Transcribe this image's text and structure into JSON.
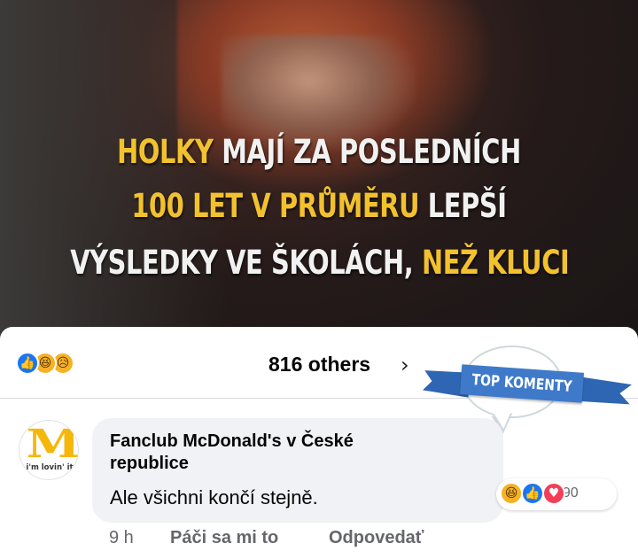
{
  "meme": {
    "line1_hl": "HOLKY",
    "line1_rest": " MAJÍ ZA POSLEDNÍCH",
    "line2_hl": "100 LET V PRŮMĚRU",
    "line2_rest": " LEPŠÍ",
    "line3_rest": "VÝSLEDKY VE ŠKOLÁCH, ",
    "line3_hl": "NEŽ KLUCI",
    "highlight_color": "#f2c12e"
  },
  "post_reactions": {
    "icons": [
      "like-icon",
      "haha-icon",
      "sad-icon"
    ],
    "others_label": "816 others",
    "chevron": "›"
  },
  "badge": {
    "label": "TOP KOMENTY"
  },
  "comment": {
    "author": "Fanclub McDonald's v České republice",
    "avatar_logo": "M",
    "avatar_slogan": "i'm lovin' it",
    "text": "Ale všichni končí stejně.",
    "reaction_icons": [
      "haha-icon",
      "like-icon",
      "love-icon"
    ],
    "reaction_count": "790",
    "time": "9 h",
    "like_action": "Páči sa mi to",
    "reply_action": "Odpovedať"
  },
  "colors": {
    "facebook_blue": "#1877f2",
    "love_red": "#f33e58",
    "haha_yellow": "#f7b125",
    "ribbon_blue": "#3e7ac9",
    "mcdonalds_yellow": "#f6b70b"
  }
}
